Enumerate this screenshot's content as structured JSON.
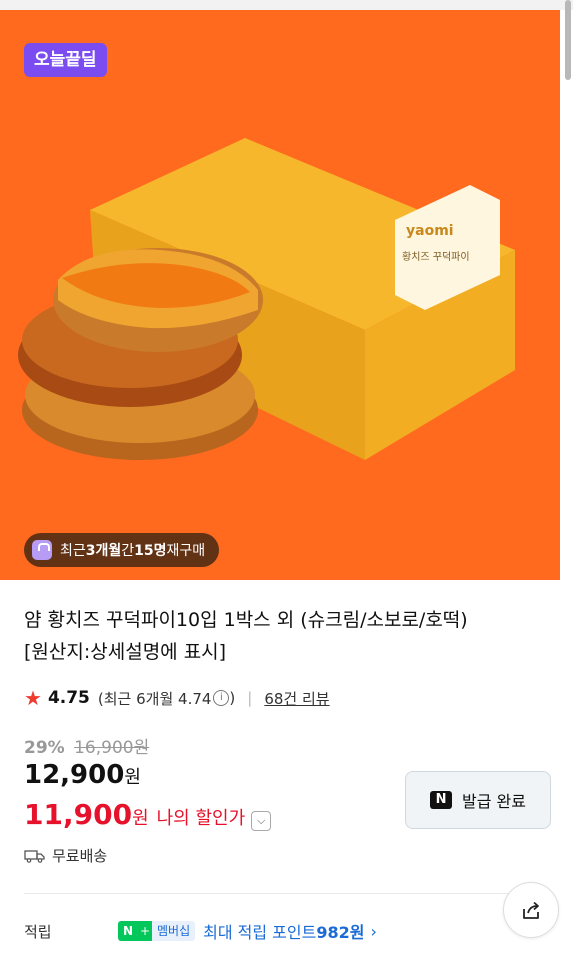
{
  "hero": {
    "deal_badge": "오늘끝딜",
    "repurchase_prefix": "최근 ",
    "repurchase_period": "3개월",
    "repurchase_mid": "간 ",
    "repurchase_count": "15명",
    "repurchase_suffix": " 재구매",
    "box_brand": "yaomi",
    "box_product": "황치즈 꾸덕파이",
    "bg_color": "#ff6a1f"
  },
  "product": {
    "title_line1": "얌 황치즈 꾸덕파이10입 1박스 외 (슈크림/소보로/호떡)",
    "title_line2": "[원산지:상세설명에 표시]"
  },
  "rating": {
    "score": "4.75",
    "recent_prefix": "(최근 6개월 4.74",
    "recent_suffix": ")",
    "reviews": "68건 리뷰"
  },
  "price": {
    "discount_pct": "29%",
    "original": "16,900원",
    "sale_value": "12,900",
    "sale_unit": "원",
    "my_value": "11,900",
    "my_unit": "원",
    "my_label": "나의 할인가"
  },
  "coupon": {
    "badge": "N",
    "label": "발급 완료"
  },
  "shipping": {
    "label": "무료배송"
  },
  "points": {
    "label": "적립",
    "badge_n": "N",
    "badge_plus": "+",
    "badge_membership": "멤버십",
    "text_prefix": "최대 적립 포인트 ",
    "amount": "982원",
    "arrow": "›"
  },
  "colors": {
    "accent_red": "#e6112a",
    "deal_purple": "#7b4cf0",
    "naver_green": "#03c75a"
  }
}
